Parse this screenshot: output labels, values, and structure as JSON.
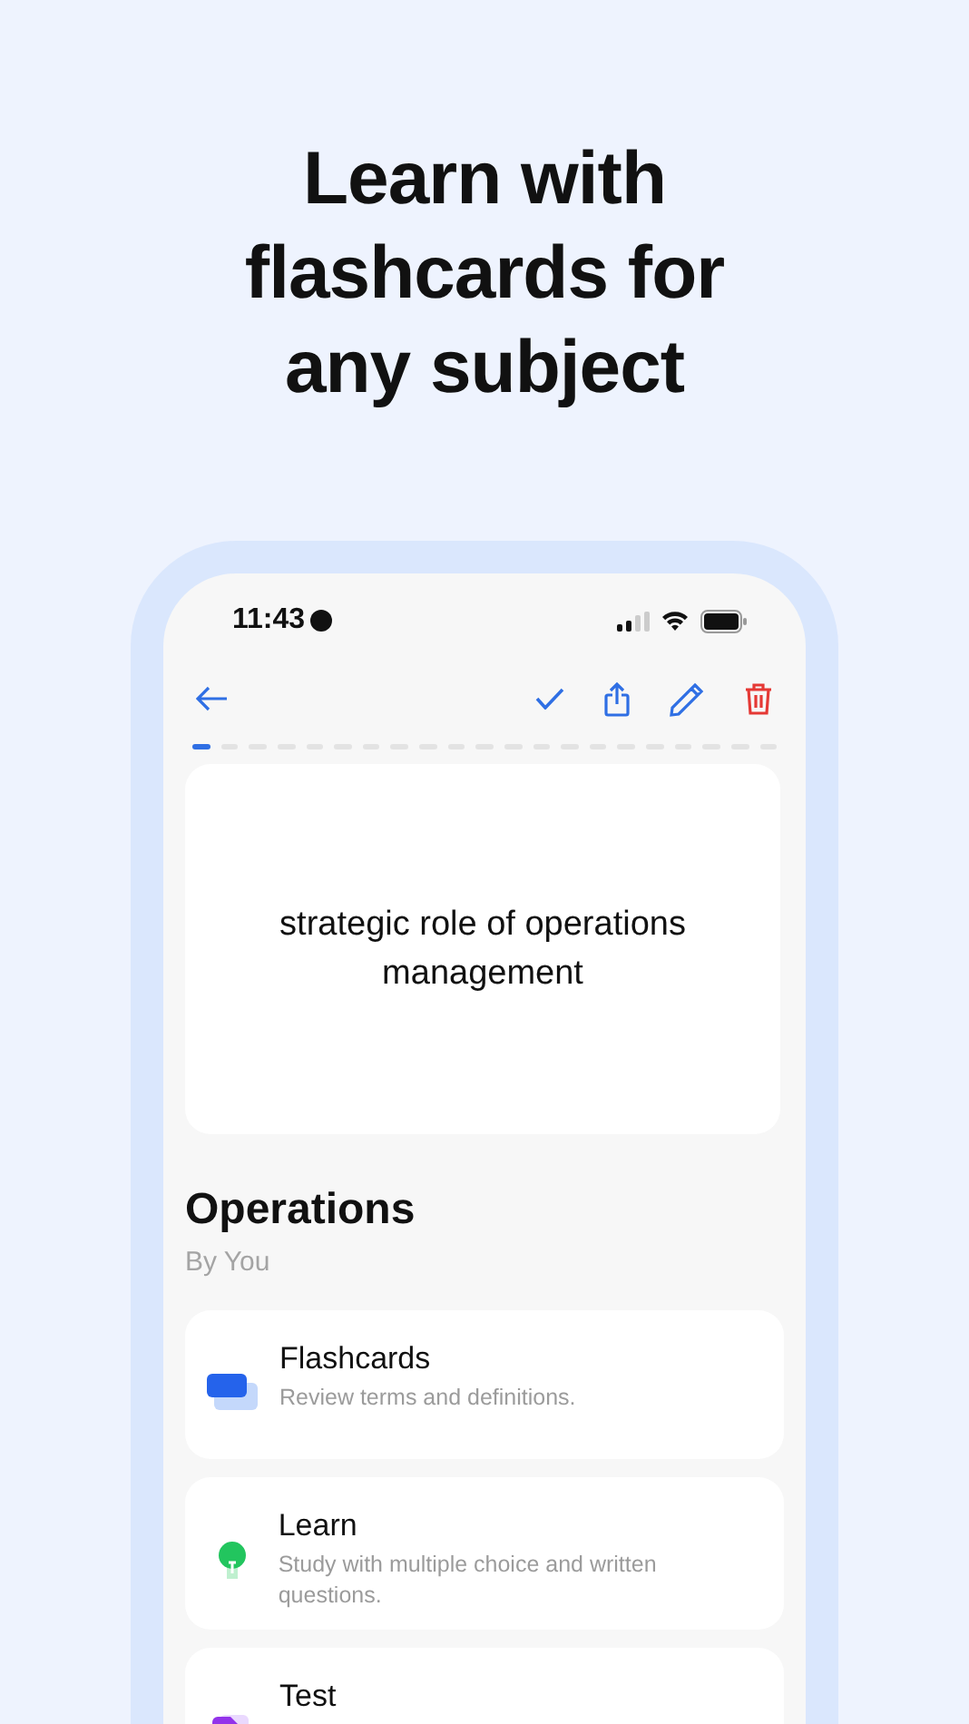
{
  "headline": "Learn with flashcards for any subject",
  "status_bar": {
    "time": "11:43"
  },
  "progress": [
    {
      "selected": true
    },
    {
      "selected": false
    },
    {
      "selected": false
    },
    {
      "selected": false
    },
    {
      "selected": false
    },
    {
      "selected": false
    },
    {
      "selected": false
    },
    {
      "selected": false
    },
    {
      "selected": false
    },
    {
      "selected": false
    },
    {
      "selected": false
    },
    {
      "selected": false
    },
    {
      "selected": false
    },
    {
      "selected": false
    },
    {
      "selected": false
    },
    {
      "selected": false
    },
    {
      "selected": false
    },
    {
      "selected": false
    },
    {
      "selected": false
    },
    {
      "selected": false
    },
    {
      "selected": false
    }
  ],
  "card": {
    "term": "strategic role of operations management"
  },
  "set": {
    "title": "Operations",
    "author": "By You"
  },
  "modes": [
    {
      "kind": "flashcards",
      "title": "Flashcards",
      "description": "Review terms and definitions."
    },
    {
      "kind": "learn",
      "title": "Learn",
      "description": "Study with multiple choice and written questions."
    },
    {
      "kind": "test",
      "title": "Test"
    }
  ]
}
